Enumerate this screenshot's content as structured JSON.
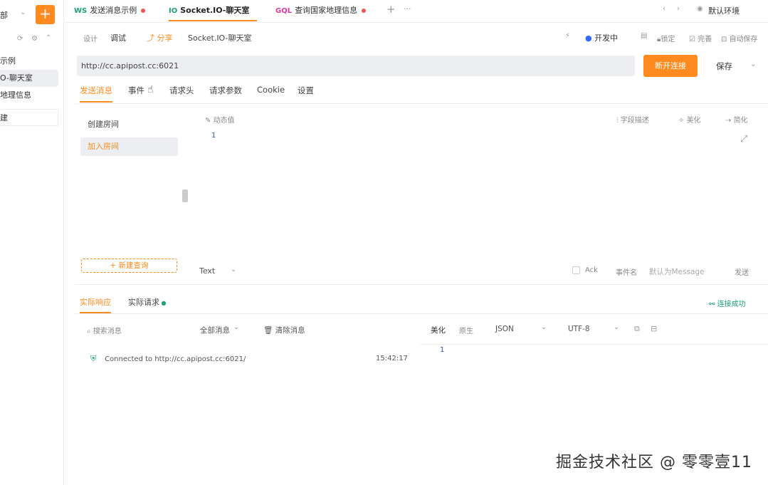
{
  "sidebar": {
    "top_label": "部",
    "add_label": "+",
    "items": [
      {
        "label": "示例"
      },
      {
        "label": "O-聊天室"
      },
      {
        "label": "地理信息"
      },
      {
        "label": "建"
      }
    ]
  },
  "tabs": [
    {
      "protocol": "WS",
      "label": "发送消息示例",
      "protocol_color": "#1aa36f"
    },
    {
      "protocol": "IO",
      "label": "Socket.IO-聊天室",
      "protocol_color": "#1aa36f"
    },
    {
      "protocol": "GQL",
      "label": "查询国家地理信息",
      "protocol_color": "#e0389c"
    }
  ],
  "tab_bar": {
    "add_label": "+",
    "more_label": "···",
    "env_label": "默认环境"
  },
  "toolbar": {
    "mode_design": "设计",
    "mode_debug": "调试",
    "share_label": "分享",
    "title": "Socket.IO-聊天室",
    "status_label": "开发中",
    "lock_label": "锁定",
    "complete_label": "完善",
    "autosave_label": "自动保存"
  },
  "url": {
    "value": "http://cc.apipost.cc:6021",
    "disconnect_label": "断开连接",
    "save_label": "保存"
  },
  "request_tabs": [
    {
      "label": "发送消息"
    },
    {
      "label": "事件"
    },
    {
      "label": "请求头"
    },
    {
      "label": "请求参数"
    },
    {
      "label": "Cookie"
    },
    {
      "label": "设置"
    }
  ],
  "editor": {
    "mock_label": "动态值",
    "field_desc_label": "字段描述",
    "beautify_label": "美化",
    "simplify_label": "简化",
    "line_number": "1"
  },
  "events": [
    {
      "label": "创建房间"
    },
    {
      "label": "加入房间"
    }
  ],
  "send_bar": {
    "new_query_label": "+ 新建查询",
    "format": "Text",
    "ack_label": "Ack",
    "event_name_label": "事件名",
    "event_name_placeholder": "默认为Message",
    "send_label": "发送"
  },
  "response": {
    "tab_actual": "实际响应",
    "tab_request": "实际请求",
    "connected_status": "连接成功",
    "search_placeholder": "搜索消息",
    "filter_label": "全部消息",
    "clear_label": "清除消息",
    "beautify_label": "美化",
    "raw_label": "原生",
    "format": "JSON",
    "encoding": "UTF-8",
    "line_number": "1",
    "messages": [
      {
        "text": "Connected to http://cc.apipost.cc:6021/",
        "time": "15:42:17"
      }
    ]
  },
  "watermark": "掘金技术社区 @ 零零壹11",
  "colors": {
    "accent": "#ff8a1f",
    "success": "#1aa36f",
    "danger": "#f25555"
  }
}
